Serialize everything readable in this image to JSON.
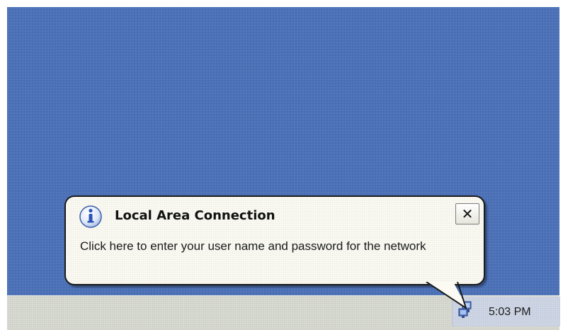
{
  "notification": {
    "title": "Local Area Connection",
    "message": "Click here to enter your user name and password for the network",
    "close_glyph": "✕",
    "icon": "info-icon"
  },
  "tray": {
    "clock": "5:03 PM",
    "network_icon": "network-icon"
  },
  "colors": {
    "desktop": "#4a6fb5",
    "taskbar": "#d9dcd3",
    "balloon": "#fbfbf3"
  }
}
